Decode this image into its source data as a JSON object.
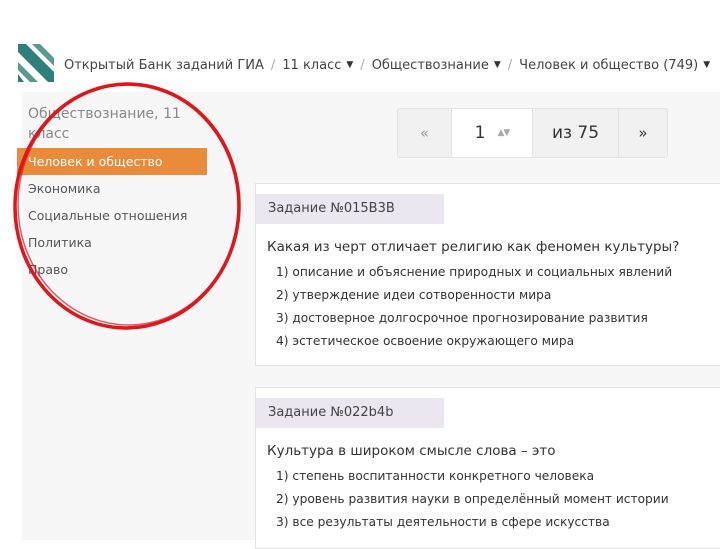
{
  "breadcrumb": [
    {
      "label": "Открытый Банк заданий ГИА",
      "has_caret": false
    },
    {
      "label": "11 класс",
      "has_caret": true
    },
    {
      "label": "Обществознание",
      "has_caret": true
    },
    {
      "label": "Человек и общество (749)",
      "has_caret": true
    }
  ],
  "breadcrumb_separator": "/",
  "sidebar": {
    "title": "Обществознание, 11 класс",
    "items": [
      {
        "label": "Человек и общество",
        "active": true
      },
      {
        "label": "Экономика",
        "active": false
      },
      {
        "label": "Социальные отношения",
        "active": false
      },
      {
        "label": "Политика",
        "active": false
      },
      {
        "label": "Право",
        "active": false
      }
    ]
  },
  "pagination": {
    "prev": "«",
    "current_page": "1",
    "total": "из 75",
    "next": "»"
  },
  "tasks": [
    {
      "tag": "Задание №015B3B",
      "question": "Какая из черт отличает религию как феномен культуры?",
      "options": [
        "1) описание и объяснение природных и социальных явлений",
        "2) утверждение идеи сотворенности мира",
        "3) достоверное долгосрочное прогнозирование развития",
        "4) эстетическое освоение окружающего мира"
      ]
    },
    {
      "tag": "Задание №022b4b",
      "question": "Культура в широком смысле слова – это",
      "options": [
        "1) степень воспитанности конкретного человека",
        "2) уровень развития науки в определённый момент истории",
        "3) все результаты деятельности в сфере искусства"
      ]
    }
  ],
  "colors": {
    "active_item": "#ea8b3c",
    "task_tag_bg": "#ebe6ef",
    "annotation": "#e0161b",
    "logo_teal": "#2f7f7a"
  },
  "icons": {
    "logo": "stripes-logo",
    "caret": "caret-down-icon",
    "spinner": "number-spinner-icon"
  }
}
